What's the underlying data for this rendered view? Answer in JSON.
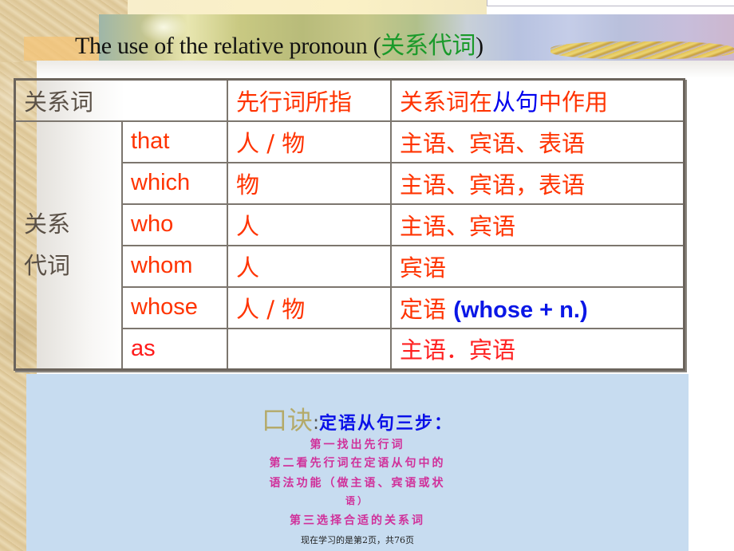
{
  "title": {
    "text_en": "The use of the relative pronoun (",
    "text_cn": "关系代词",
    "text_close": ")"
  },
  "table": {
    "header": {
      "col_relative_word": "关系词",
      "col_antecedent": "先行词所指",
      "col_function_part1": "关系词在",
      "col_function_part2": "从句",
      "col_function_part3": "中作用"
    },
    "group_label_line1": "关系",
    "group_label_line2": "代词",
    "rows": [
      {
        "pronoun": "that",
        "antecedent": "人 / 物",
        "function": "主语、宾语、表语",
        "function_extra": ""
      },
      {
        "pronoun": "which",
        "antecedent": "物",
        "function": "主语、宾语，表语",
        "function_extra": ""
      },
      {
        "pronoun": "who",
        "antecedent": "人",
        "function": "主语、宾语",
        "function_extra": ""
      },
      {
        "pronoun": "whom",
        "antecedent": "人",
        "function": "宾语",
        "function_extra": ""
      },
      {
        "pronoun": "whose",
        "antecedent": "人 / 物",
        "function": "定语 ",
        "function_extra": "(whose + n.)"
      },
      {
        "pronoun": "as",
        "antecedent": "",
        "function": "主语．宾语",
        "function_extra": ""
      }
    ]
  },
  "tip": {
    "label": "口诀",
    "colon": ":",
    "heading": "定语从句三步：",
    "lines": [
      "第一找出先行词",
      "第二看先行词在定语从句中的",
      "语法功能（做主语、宾语或状",
      "语）",
      "第三选择合适的关系词"
    ]
  },
  "footer": {
    "text": "现在学习的是第2页，共76页"
  },
  "colors": {
    "title_cn": "#1a9a2a",
    "table_red": "#ff3300",
    "highlight_blue": "#0000ee",
    "tip_background": "#c7dcf0",
    "tip_heading": "#0a10e8",
    "tip_lines": "#d0309a"
  }
}
